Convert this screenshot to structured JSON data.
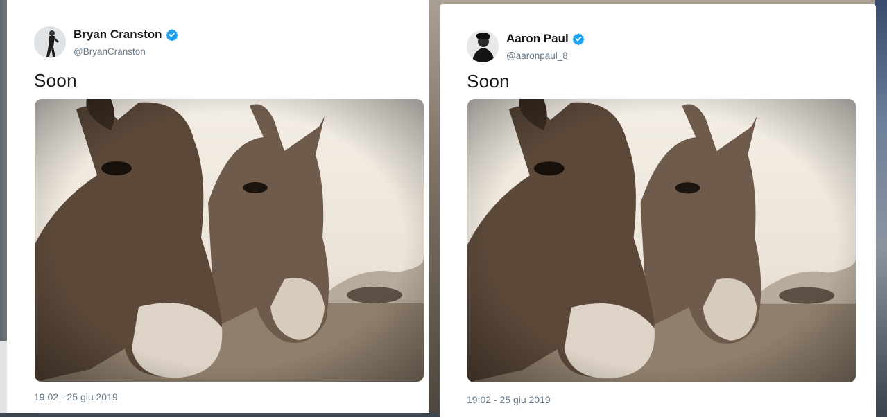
{
  "tweets": [
    {
      "display_name": "Bryan Cranston",
      "handle": "@BryanCranston",
      "text": "Soon",
      "timestamp": "19:02 - 25 giu 2019",
      "verified_icon": "verified-badge-icon"
    },
    {
      "display_name": "Aaron Paul",
      "handle": "@aaronpaul_8",
      "text": "Soon",
      "timestamp": "19:02 - 25 giu 2019",
      "verified_icon": "verified-badge-icon"
    }
  ],
  "colors": {
    "verified": "#1da1f2",
    "name": "#14171a",
    "secondary": "#657786",
    "photo_tone": "#8a7766"
  }
}
